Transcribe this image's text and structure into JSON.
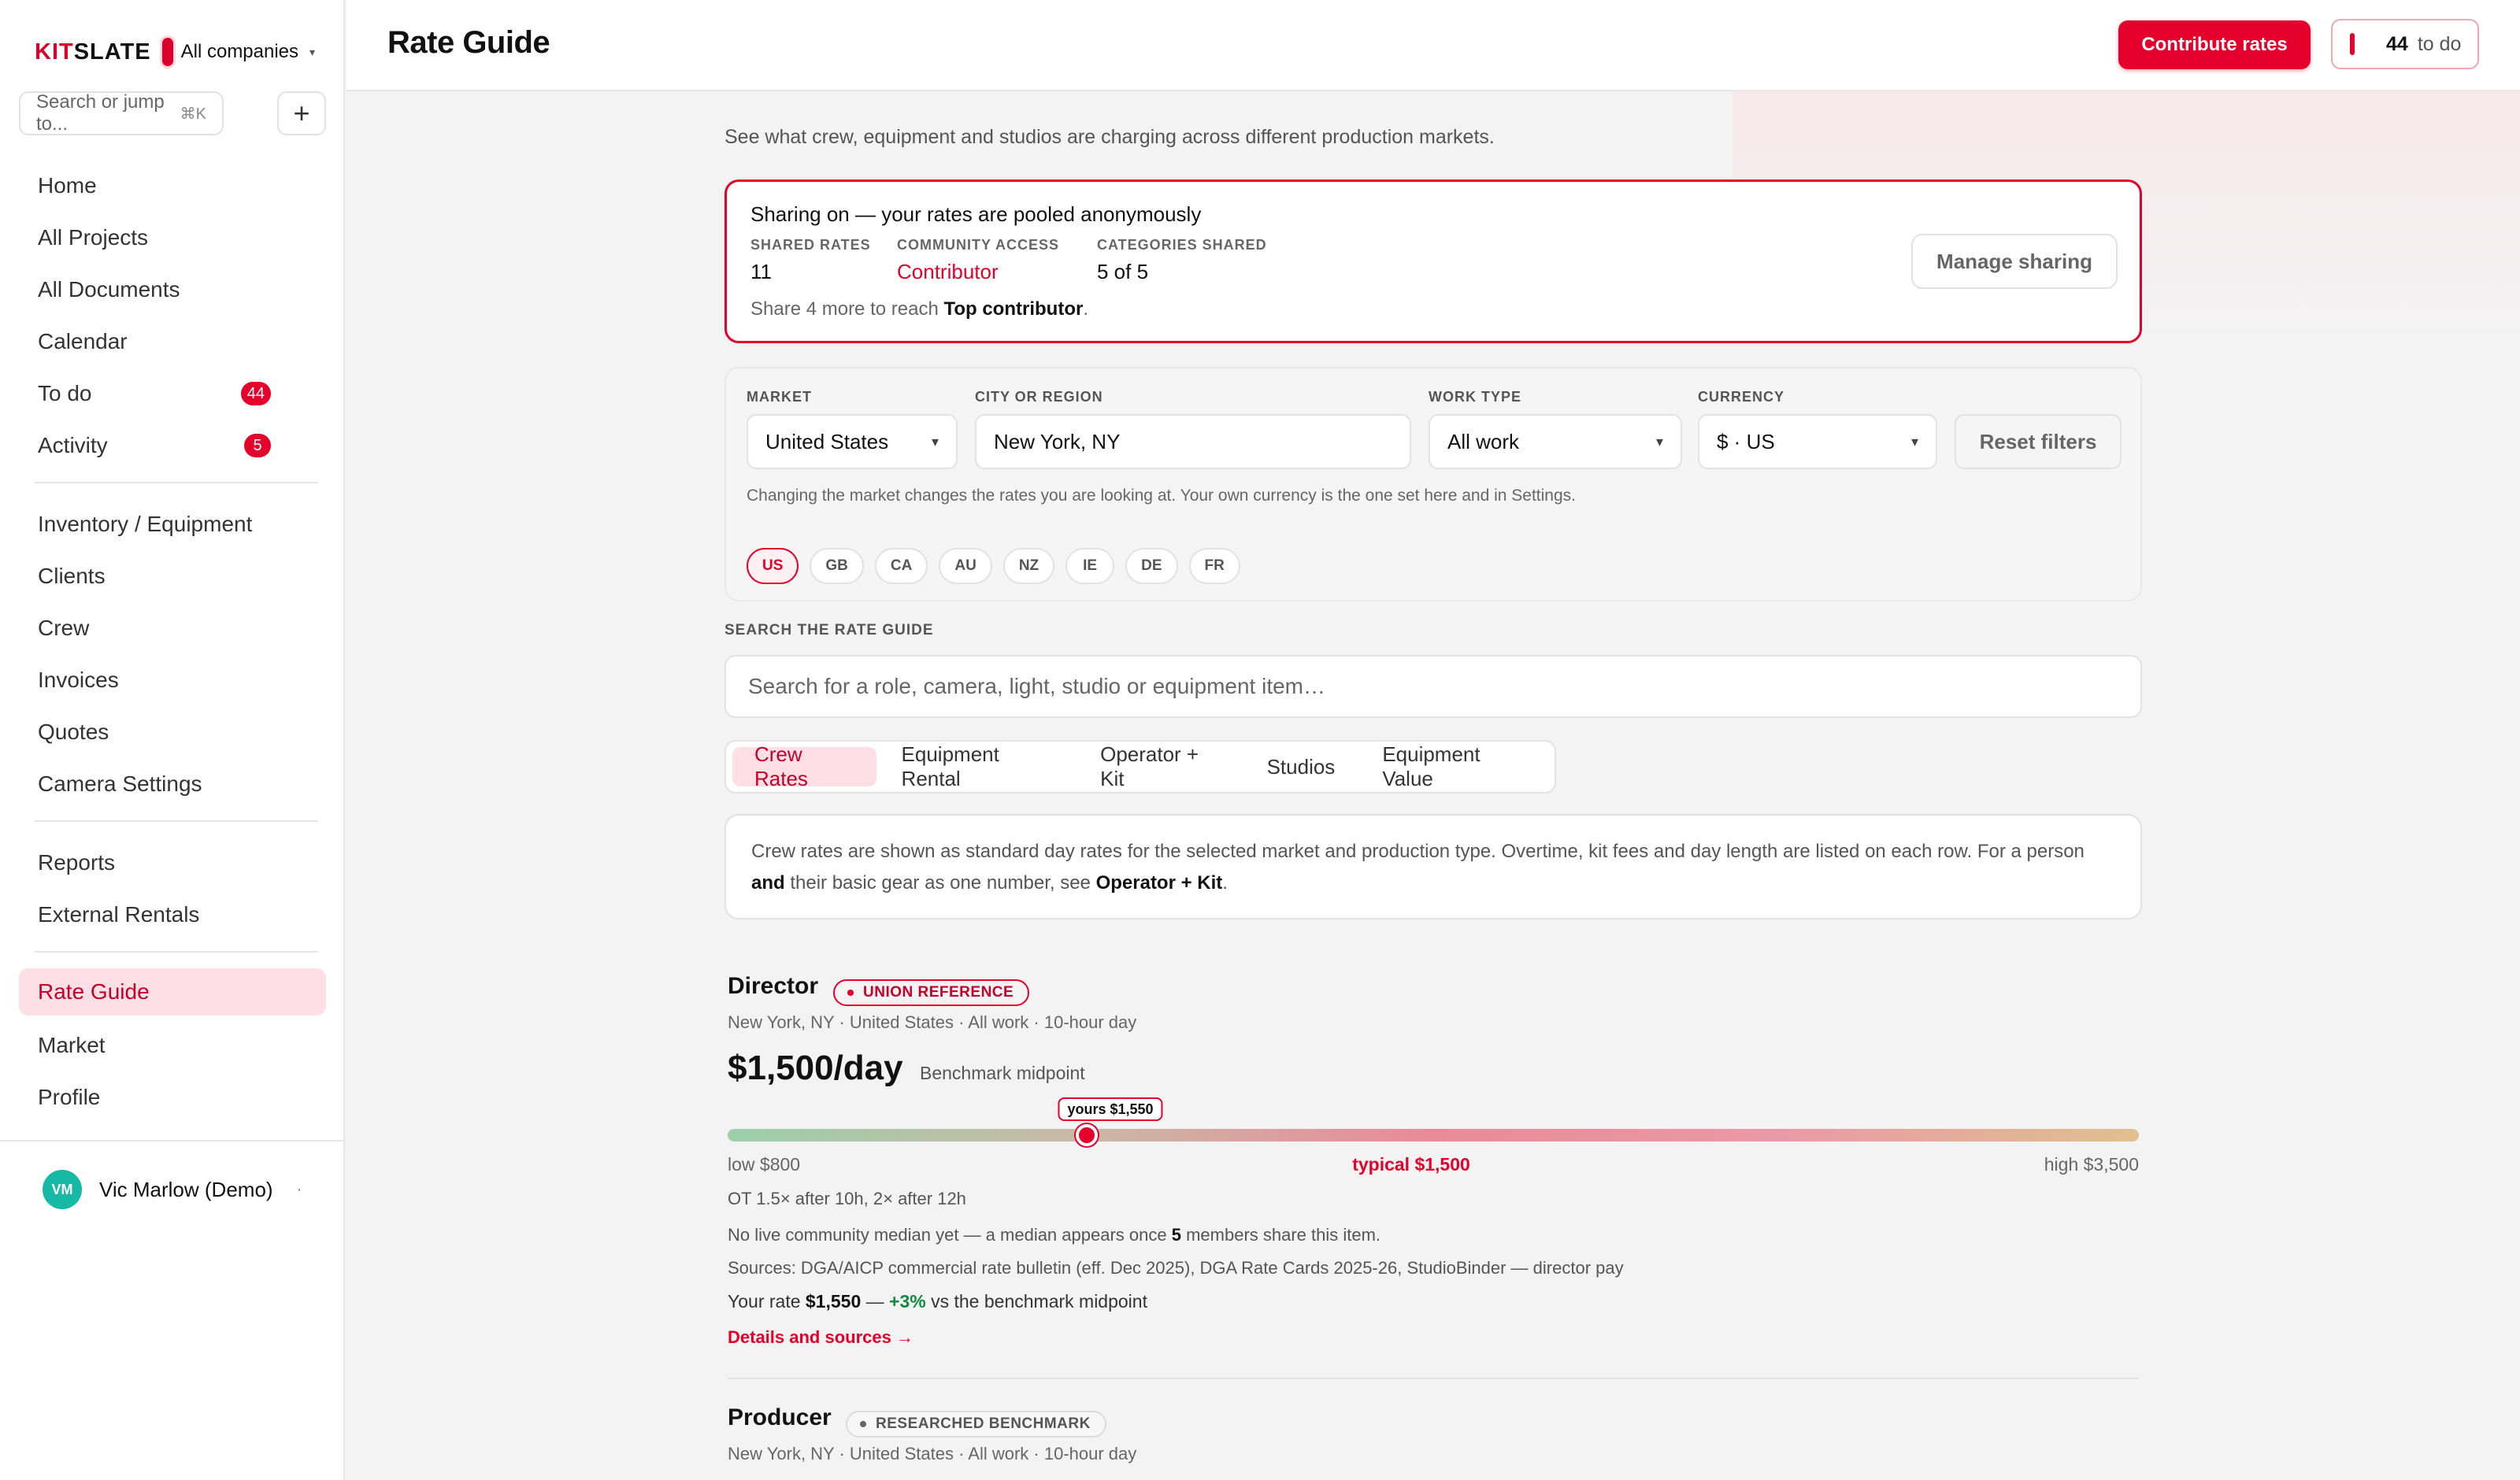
{
  "brand": {
    "logo_a": "KIT",
    "logo_b": "SLATE",
    "company": "All companies",
    "caret": "▾"
  },
  "sidebar": {
    "search_placeholder": "Search or jump to...",
    "search_shortcut": "⌘K",
    "add_label": "+",
    "items": [
      {
        "label": "Home"
      },
      {
        "label": "All Projects"
      },
      {
        "label": "All Documents"
      },
      {
        "label": "Calendar"
      },
      {
        "label": "To do",
        "badge": "44"
      },
      {
        "label": "Activity",
        "badge": "5"
      },
      {
        "label": "Inventory / Equipment"
      },
      {
        "label": "Clients"
      },
      {
        "label": "Crew"
      },
      {
        "label": "Invoices"
      },
      {
        "label": "Quotes"
      },
      {
        "label": "Camera Settings"
      },
      {
        "label": "Reports"
      },
      {
        "label": "External Rentals"
      },
      {
        "label": "Rate Guide",
        "active": true
      },
      {
        "label": "Market"
      },
      {
        "label": "Profile"
      }
    ],
    "user": {
      "initials": "VM",
      "name": "Vic Marlow (Demo)",
      "more": "·"
    }
  },
  "header": {
    "title": "Rate Guide",
    "contribute_label": "Contribute rates",
    "todo_count": "44",
    "todo_label": "to do"
  },
  "main": {
    "subtitle": "See what crew, equipment and studios are charging across different production markets.",
    "sharing": {
      "title": "Sharing on — your rates are pooled anonymously",
      "stats": [
        {
          "label": "SHARED RATES",
          "value": "11"
        },
        {
          "label": "COMMUNITY ACCESS",
          "value": "Contributor"
        },
        {
          "label": "CATEGORIES SHARED",
          "value": "5 of 5"
        }
      ],
      "foot_prefix": "Share 4 more to reach ",
      "foot_bold": "Top contributor",
      "foot_suffix": ".",
      "manage_label": "Manage sharing"
    },
    "filters": {
      "market": {
        "label": "MARKET",
        "value": "United States"
      },
      "city": {
        "label": "CITY OR REGION",
        "value": "New York, NY"
      },
      "work_type": {
        "label": "WORK TYPE",
        "value": "All work"
      },
      "currency": {
        "label": "CURRENCY",
        "value": "$ · US"
      },
      "caret": "▾",
      "reset_label": "Reset filters",
      "note": "Changing the market changes the rates you are looking at. Your own currency is the one set here and in Settings.",
      "chips": [
        "US",
        "GB",
        "CA",
        "AU",
        "NZ",
        "IE",
        "DE",
        "FR"
      ],
      "active_chip": "US"
    },
    "search": {
      "label": "SEARCH THE RATE GUIDE",
      "placeholder": "Search for a role, camera, light, studio or equipment item…"
    },
    "tabs": [
      "Crew Rates",
      "Equipment Rental",
      "Operator + Kit",
      "Studios",
      "Equipment Value"
    ],
    "active_tab": "Crew Rates",
    "info": {
      "text_a": "Crew rates are shown as standard day rates for the selected market and production type. Overtime, kit fees and day length are listed on each row. For a person ",
      "bold_a": "and",
      "text_b": " their basic gear as one number, see ",
      "bold_b": "Operator + Kit",
      "text_c": "."
    },
    "rates": [
      {
        "name": "Director",
        "badge": "UNION REFERENCE",
        "meta": "New York, NY · United States · All work · 10-hour day",
        "price": "$1,500/day",
        "price_note": "Benchmark midpoint",
        "range": {
          "low": 800,
          "typical": 1500,
          "high": 3500,
          "yours": 1550
        },
        "range_labels": {
          "low": "low $800",
          "typical": "typical $1,500",
          "high": "high $3,500",
          "yours": "yours $1,550"
        },
        "ot": "OT 1.5× after 10h, 2× after 12h",
        "community_prefix": "No live community median yet — a median appears once ",
        "community_bold": "5",
        "community_suffix": " members share this item.",
        "sources": "Sources: DGA/AICP commercial rate bulletin (eff. Dec 2025), DGA Rate Cards 2025-26, StudioBinder — director pay",
        "your_prefix": "Your rate ",
        "your_value": "$1,550",
        "your_dash": " — ",
        "your_delta": "+3%",
        "your_suffix": " vs the benchmark midpoint",
        "details": "Details and sources →"
      },
      {
        "name": "Producer",
        "badge": "RESEARCHED BENCHMARK",
        "meta": "New York, NY · United States · All work · 10-hour day"
      }
    ]
  },
  "colors": {
    "accent": "#e4002b",
    "accent_soft": "#fde0e5",
    "positive": "#0f8a3e",
    "avatar": "#16b8a6"
  }
}
